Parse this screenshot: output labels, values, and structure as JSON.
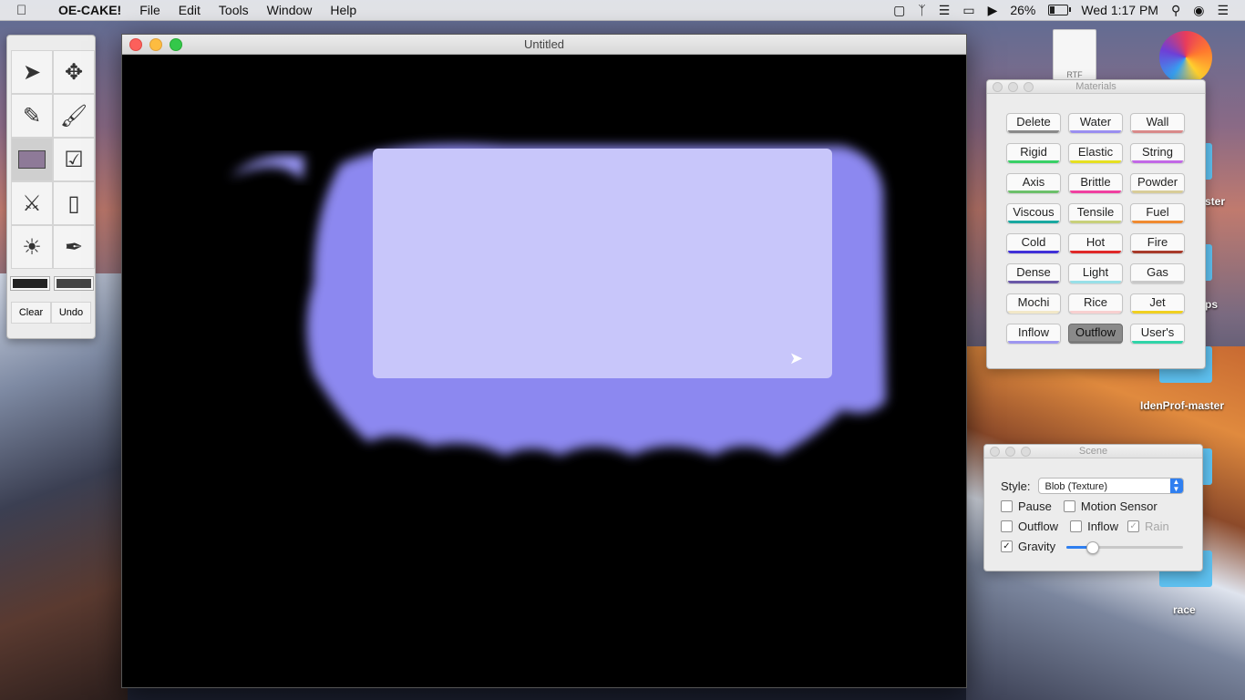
{
  "menubar": {
    "app": "OE-CAKE!",
    "menus": [
      "File",
      "Edit",
      "Tools",
      "Window",
      "Help"
    ],
    "battery": "26%",
    "clock": "Wed 1:17 PM"
  },
  "toolbar": {
    "tools": [
      {
        "name": "select-arrow-icon"
      },
      {
        "name": "move-icon"
      },
      {
        "name": "pencil-icon"
      },
      {
        "name": "brush-icon"
      },
      {
        "name": "rectangle-icon",
        "active": true
      },
      {
        "name": "fill-bucket-icon"
      },
      {
        "name": "knife-icon"
      },
      {
        "name": "eraser-icon"
      },
      {
        "name": "flashlight-icon"
      },
      {
        "name": "eyedropper-icon"
      }
    ],
    "clear_label": "Clear",
    "undo_label": "Undo",
    "swatch_colors": [
      "#222222",
      "#444444"
    ]
  },
  "main_window": {
    "title": "Untitled"
  },
  "materials": {
    "title": "Materials",
    "items": [
      {
        "label": "Delete",
        "color": "#8a8a8a"
      },
      {
        "label": "Water",
        "color": "#9a8ef0"
      },
      {
        "label": "Wall",
        "color": "#d98a8a"
      },
      {
        "label": "Rigid",
        "color": "#38d066"
      },
      {
        "label": "Elastic",
        "color": "#e6e020"
      },
      {
        "label": "String",
        "color": "#c268e6"
      },
      {
        "label": "Axis",
        "color": "#6cc06a"
      },
      {
        "label": "Brittle",
        "color": "#f03fa0"
      },
      {
        "label": "Powder",
        "color": "#d8cc98"
      },
      {
        "label": "Viscous",
        "color": "#19a8a0"
      },
      {
        "label": "Tensile",
        "color": "#c8d07a"
      },
      {
        "label": "Fuel",
        "color": "#f08a30"
      },
      {
        "label": "Cold",
        "color": "#4030d8"
      },
      {
        "label": "Hot",
        "color": "#e02828"
      },
      {
        "label": "Fire",
        "color": "#a83a2a"
      },
      {
        "label": "Dense",
        "color": "#6a58a8"
      },
      {
        "label": "Light",
        "color": "#98e0e8"
      },
      {
        "label": "Gas",
        "color": "#c8c8c8"
      },
      {
        "label": "Mochi",
        "color": "#f2e8c8"
      },
      {
        "label": "Rice",
        "color": "#f8d0d0"
      },
      {
        "label": "Jet",
        "color": "#f0d020"
      },
      {
        "label": "Inflow",
        "color": "#9e96f0"
      },
      {
        "label": "Outflow",
        "color": "#7a7a7a",
        "selected": true
      },
      {
        "label": "User's",
        "color": "#30d4a8"
      }
    ]
  },
  "scene": {
    "title": "Scene",
    "style_label": "Style:",
    "style_value": "Blob (Texture)",
    "pause_label": "Pause",
    "motion_sensor_label": "Motion Sensor",
    "outflow_label": "Outflow",
    "inflow_label": "Inflow",
    "rain_label": "Rain",
    "gravity_label": "Gravity",
    "gravity_level": 0.22,
    "checks": {
      "pause": false,
      "motion_sensor": false,
      "outflow": false,
      "inflow": false,
      "rain": true,
      "gravity": true
    }
  },
  "desktop": {
    "rtf_label": "RTF",
    "labels": [
      "ster",
      "ps",
      "IdenProf-master",
      "race"
    ]
  }
}
